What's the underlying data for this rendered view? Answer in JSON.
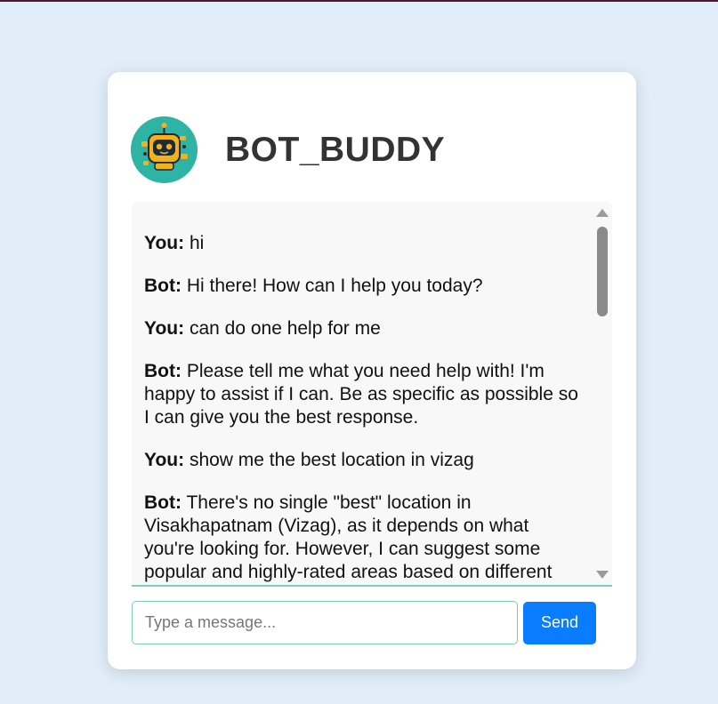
{
  "app": {
    "title": "BOT_BUDDY",
    "avatar_icon": "robot-icon",
    "accent_color": "#0a7cff",
    "avatar_bg": "#2fb3a5"
  },
  "chat": {
    "messages": [
      {
        "sender": "You:",
        "text": " hi"
      },
      {
        "sender": "Bot:",
        "text": " Hi there! How can I help you today?"
      },
      {
        "sender": "You:",
        "text": " can do one help for me"
      },
      {
        "sender": "Bot:",
        "text": " Please tell me what you need help with! I'm happy to assist if I can. Be as specific as possible so I can give you the best response."
      },
      {
        "sender": "You:",
        "text": " show me the best location in vizag"
      },
      {
        "sender": "Bot:",
        "text": " There's no single \"best\" location in Visakhapatnam (Vizag), as it depends on what you're looking for. However, I can suggest some popular and highly-rated areas based on different"
      }
    ]
  },
  "composer": {
    "placeholder": "Type a message...",
    "value": "",
    "send_label": "Send"
  }
}
